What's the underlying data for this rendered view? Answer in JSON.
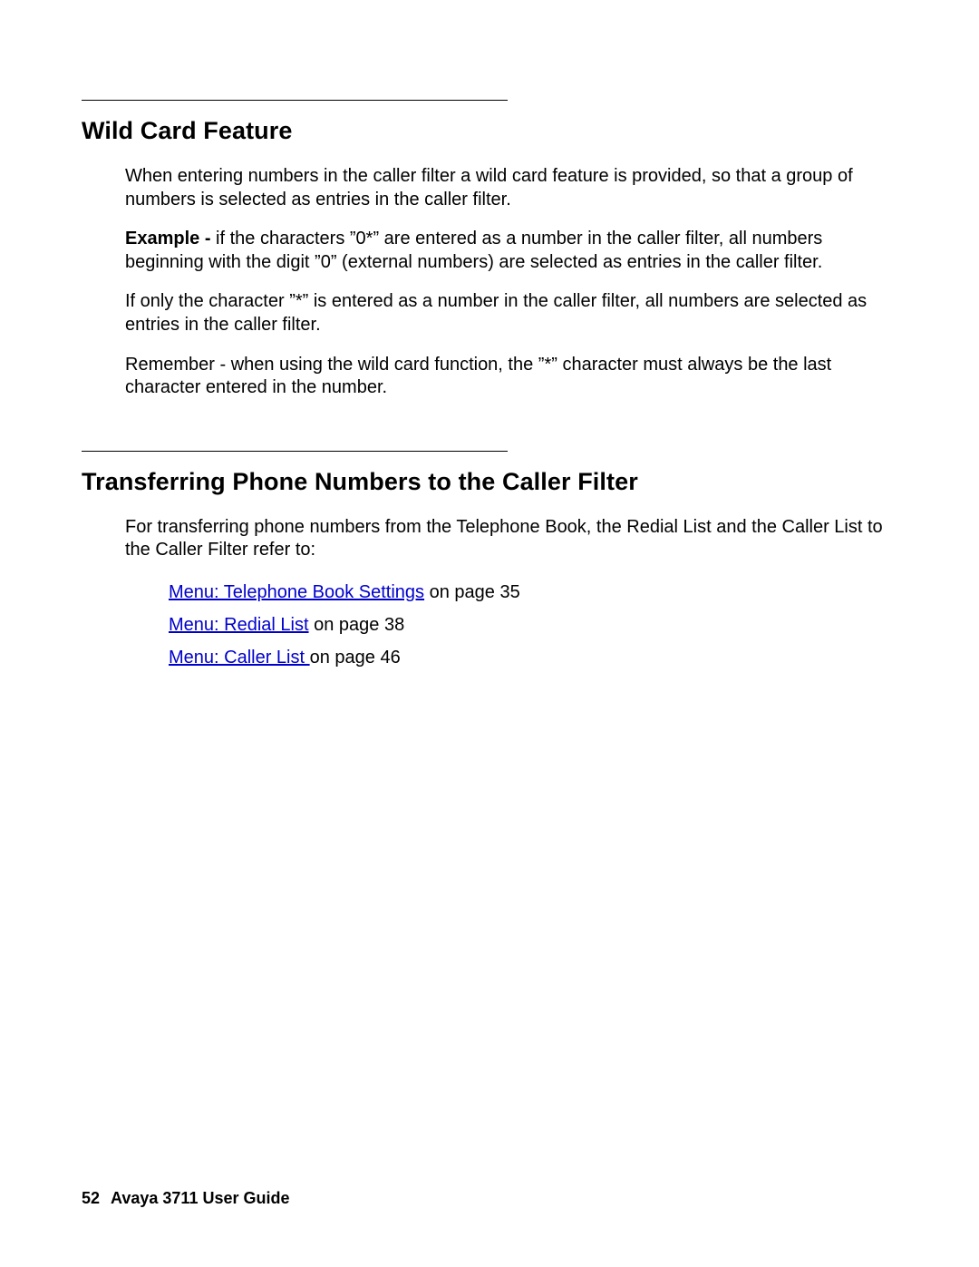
{
  "section1": {
    "heading": "Wild Card Feature",
    "p1": "When entering numbers in the caller filter a wild card feature is provided, so that a group of numbers is selected as entries in the caller filter.",
    "example_label": "Example - ",
    "p2_rest": "if the characters ”0*” are entered as a number in the caller filter, all numbers beginning with the digit ”0” (external numbers) are selected as entries in the caller filter.",
    "p3": "If only the character ”*” is entered as a number in the caller filter, all numbers are selected as entries in the caller filter.",
    "p4": "Remember - when using the wild card function, the ”*” character must always be the last character entered in the number."
  },
  "section2": {
    "heading": "Transferring Phone Numbers to the Caller Filter",
    "intro": "For transferring phone numbers from the Telephone Book, the Redial List and the Caller List to the Caller Filter refer to:",
    "refs": [
      {
        "link": "Menu: Telephone Book Settings",
        "suffix": " on page 35"
      },
      {
        "link": "Menu: Redial List",
        "suffix": " on page 38"
      },
      {
        "link": "Menu: Caller List ",
        "suffix": " on page 46"
      }
    ]
  },
  "footer": {
    "page": "52",
    "title": "Avaya 3711 User Guide"
  }
}
